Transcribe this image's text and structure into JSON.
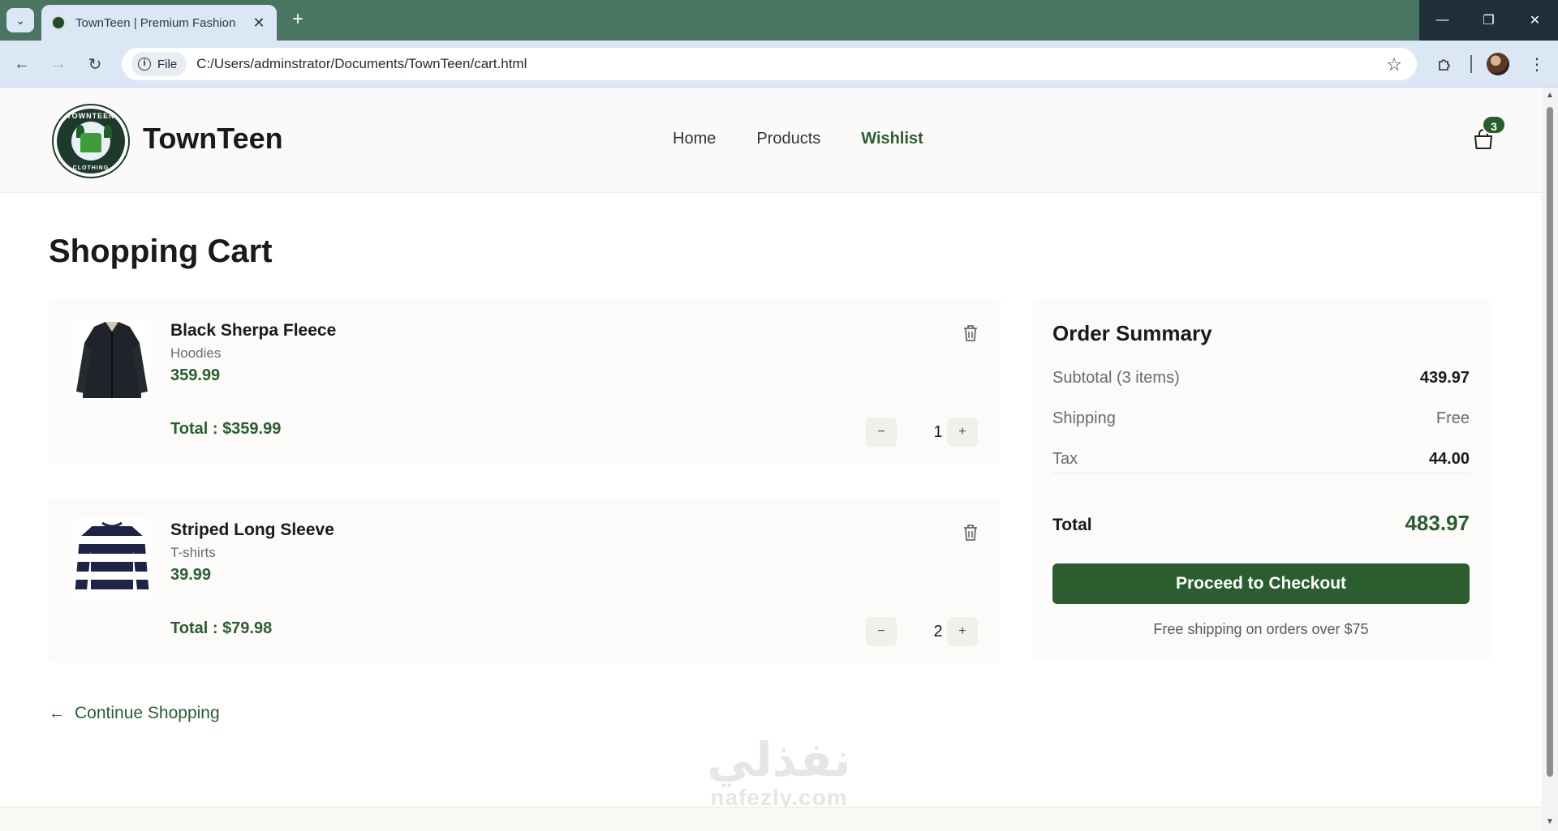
{
  "browser": {
    "tab_title": "TownTeen | Premium Fashion",
    "chip_label": "File",
    "url": "C:/Users/adminstrator/Documents/TownTeen/cart.html"
  },
  "site": {
    "brand": "TownTeen",
    "logo_text_top": "TOWNTEEN",
    "logo_text_bottom": "CLOTHING",
    "nav": [
      "Home",
      "Products",
      "Wishlist"
    ],
    "active_nav": "Wishlist",
    "cart_count": "3"
  },
  "cart": {
    "title": "Shopping Cart",
    "items": [
      {
        "name": "Black Sherpa Fleece",
        "category": "Hoodies",
        "price": "359.99",
        "quantity": "1",
        "total": "Total : $359.99"
      },
      {
        "name": "Striped Long Sleeve",
        "category": "T-shirts",
        "price": "39.99",
        "quantity": "2",
        "total": "Total : $79.98"
      }
    ],
    "continue_label": "Continue Shopping"
  },
  "summary": {
    "title": "Order Summary",
    "subtotal_label": "Subtotal (3 items)",
    "subtotal_value": "439.97",
    "shipping_label": "Shipping",
    "shipping_value": "Free",
    "tax_label": "Tax",
    "tax_value": "44.00",
    "total_label": "Total",
    "total_value": "483.97",
    "checkout_label": "Proceed to Checkout",
    "shipping_note": "Free shipping on orders over $75"
  },
  "watermark": {
    "arabic": "نفذلي",
    "latin": "nafezly.com"
  },
  "colors": {
    "brand_green": "#2a5e2e",
    "titlebar": "#4a7563",
    "toolbar": "#dbe7f5"
  }
}
